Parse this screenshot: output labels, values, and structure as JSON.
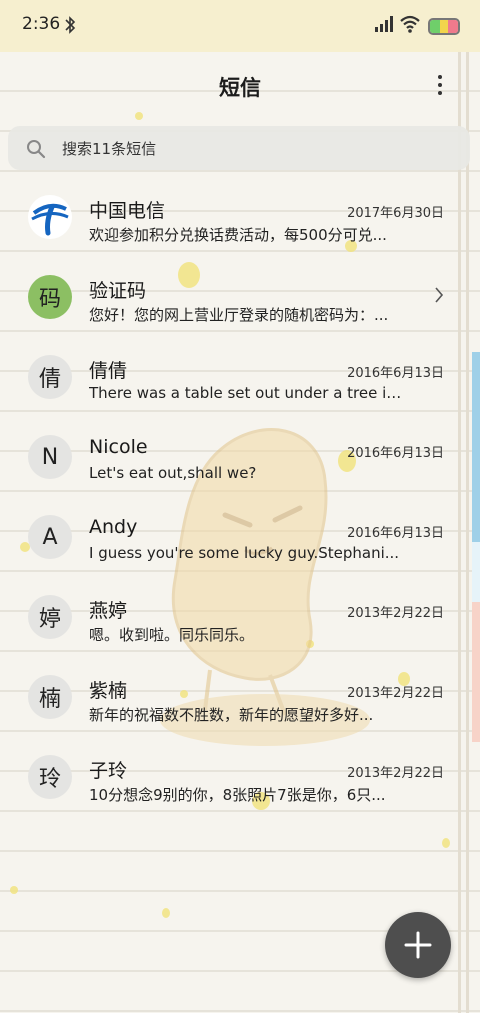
{
  "status": {
    "time": "2:36"
  },
  "appbar": {
    "title": "短信"
  },
  "search": {
    "placeholder": "搜索11条短信"
  },
  "conversations": [
    {
      "avatar": "",
      "name": "中国电信",
      "date": "2017年6月30日",
      "preview": "欢迎参加积分兑换话费活动，每500分可兑..."
    },
    {
      "avatar": "码",
      "name": "验证码",
      "date": "",
      "preview": "您好！您的网上营业厅登录的随机密码为：..."
    },
    {
      "avatar": "倩",
      "name": "倩倩",
      "date": "2016年6月13日",
      "preview": "There was a table set out under a tree in..."
    },
    {
      "avatar": "N",
      "name": "Nicole",
      "date": "2016年6月13日",
      "preview": "Let's eat out,shall we?"
    },
    {
      "avatar": "A",
      "name": "Andy",
      "date": "2016年6月13日",
      "preview": "I guess you're some lucky guy.Stephani..."
    },
    {
      "avatar": "婷",
      "name": "燕婷",
      "date": "2013年2月22日",
      "preview": "嗯。收到啦。同乐同乐。"
    },
    {
      "avatar": "楠",
      "name": "紫楠",
      "date": "2013年2月22日",
      "preview": "新年的祝福数不胜数，新年的愿望好多好..."
    },
    {
      "avatar": "玲",
      "name": "子玲",
      "date": "2013年2月22日",
      "preview": "10分想念9别的你，8张照片7张是你，6只..."
    }
  ],
  "colors": {
    "accent_avatar_green": "#8cbf63",
    "fab": "#4e4e4e",
    "statusbar": "#f6efcf"
  },
  "icons": [
    "bluetooth-icon",
    "signal-icon",
    "wifi-icon",
    "battery-icon",
    "more-vert-icon",
    "search-icon",
    "chevron-right-icon",
    "plus-icon",
    "china-telecom-logo"
  ]
}
